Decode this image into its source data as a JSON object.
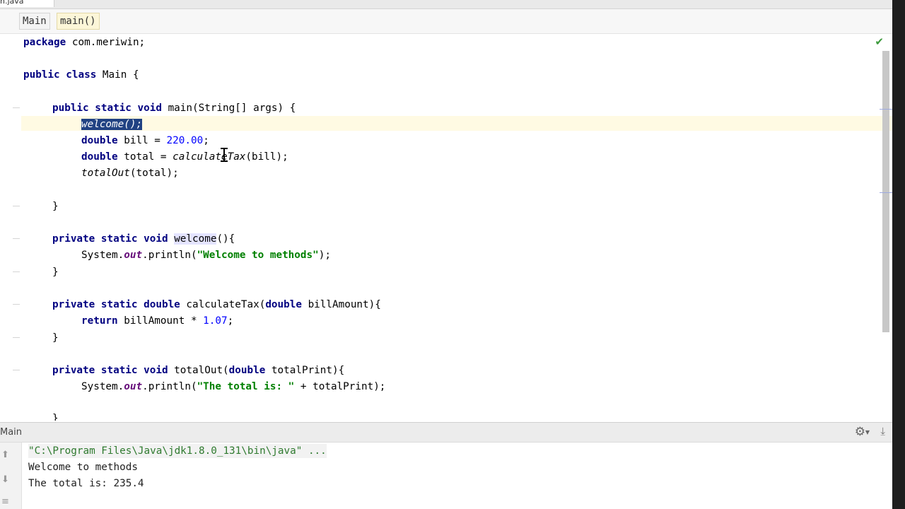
{
  "tab": {
    "file_label": "n.java"
  },
  "breadcrumbs": [
    {
      "label": "Main"
    },
    {
      "label": "main()"
    }
  ],
  "editor": {
    "lines": {
      "l1_kw": "package",
      "l1_rest": " com.meriwin;",
      "l3_kw1": "public",
      "l3_kw2": "class",
      "l3_rest": " Main {",
      "l5_kw1": "public",
      "l5_kw2": "static",
      "l5_kw3": "void",
      "l5_rest": " main(String[] args) {",
      "l6_sel": "welcome();",
      "l7_kw": "double",
      "l7_mid": " bill = ",
      "l7_num": "220.00",
      "l7_end": ";",
      "l8_kw": "double",
      "l8_mid": " total = ",
      "l8_call": "calculateTax",
      "l8_end": "(bill);",
      "l9_call": "totalOut",
      "l9_end": "(total);",
      "l11": "}",
      "l13_kw1": "private",
      "l13_kw2": "static",
      "l13_kw3": "void",
      "l13_name": "welcome",
      "l13_end": "(){",
      "l14_a": "System.",
      "l14_out": "out",
      "l14_b": ".println(",
      "l14_str": "\"Welcome to methods\"",
      "l14_end": ");",
      "l15": "}",
      "l17_kw1": "private",
      "l17_kw2": "static",
      "l17_kw3": "double",
      "l17_name": " calculateTax(",
      "l17_kw4": "double",
      "l17_end": " billAmount){",
      "l18_kw": "return",
      "l18_mid": " billAmount * ",
      "l18_num": "1.07",
      "l18_end": ";",
      "l19": "}",
      "l21_kw1": "private",
      "l21_kw2": "static",
      "l21_kw3": "void",
      "l21_name": " totalOut(",
      "l21_kw4": "double",
      "l21_end": " totalPrint){",
      "l22_a": "System.",
      "l22_out": "out",
      "l22_b": ".println(",
      "l22_str": "\"The total is: \"",
      "l22_end": " + totalPrint);",
      "l23": "}"
    }
  },
  "run_panel": {
    "title": "Main",
    "console": [
      "\"C:\\Program Files\\Java\\jdk1.8.0_131\\bin\\java\" ...",
      "Welcome to methods",
      "The total is: 235.4"
    ]
  },
  "icons": [
    "checkmark-icon",
    "gear-icon",
    "pin-icon",
    "rerun-icon",
    "stop-icon",
    "wrap-icon"
  ],
  "colors": {
    "keyword": "#000080",
    "string": "#008000",
    "number": "#0000ff",
    "selection": "#214283",
    "current_line": "#fffae3"
  }
}
